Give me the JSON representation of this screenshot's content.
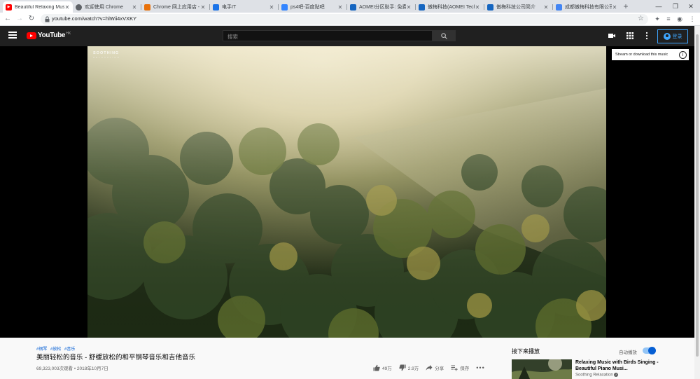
{
  "browser": {
    "tabs": [
      {
        "title": "Beautiful Relaxing Music",
        "icon": "youtube-icon",
        "color": "#ff0000",
        "active": true
      },
      {
        "title": "欢迎使用 Chrome",
        "icon": "chrome-icon",
        "color": "#5f6368",
        "active": false
      },
      {
        "title": "Chrome 网上应用店 - ",
        "icon": "webstore-icon",
        "color": "#e8710a",
        "active": false
      },
      {
        "title": "电手IT",
        "icon": "site-icon",
        "color": "#1a73e8",
        "active": false
      },
      {
        "title": "ps4吧-百度贴吧",
        "icon": "paw-icon",
        "color": "#3385ff",
        "active": false
      },
      {
        "title": "AOMEI分区助手: 免费",
        "icon": "aomei-icon",
        "color": "#1565c0",
        "active": false
      },
      {
        "title": "傲梅科技(AOMEI Tech)",
        "icon": "aomei-icon",
        "color": "#1565c0",
        "active": false
      },
      {
        "title": "傲梅科技公司简介",
        "icon": "aomei-icon",
        "color": "#1565c0",
        "active": false
      },
      {
        "title": "成都傲梅科技有限公司",
        "icon": "shield-icon",
        "color": "#4285f4",
        "active": false
      }
    ],
    "url": "youtube.com/watch?v=hlWii4xVXKY"
  },
  "youtube": {
    "logo_text": "YouTube",
    "region": "HK",
    "search_placeholder": "搜索",
    "signin_label": "登录"
  },
  "player": {
    "brand": "SOOTHING",
    "brand_sub": "RELAXATION",
    "stream_tooltip": "Stream or download this music"
  },
  "video": {
    "tags": [
      "#钢琴",
      "#放松",
      "#音乐"
    ],
    "title": "美丽轻松的音乐 - 舒缓放松的和平钢琴音乐和吉他音乐",
    "meta": "69,323,003次观看 • 2018年10月7日",
    "actions": {
      "like": "49万",
      "dislike": "2.9万",
      "share": "分享",
      "save": "保存"
    }
  },
  "sidebar": {
    "up_next": "接下来播放",
    "autoplay": "自动播放",
    "autoplay_on": true,
    "next_video": {
      "title": "Relaxing Music with Birds Singing - Beautiful Piano Musi...",
      "channel": "Soothing Relaxation"
    }
  },
  "colors": {
    "youtube_red": "#ff0000",
    "header_bg": "#202020",
    "link_blue": "#065fd4",
    "signin_blue": "#3ea6ff"
  }
}
